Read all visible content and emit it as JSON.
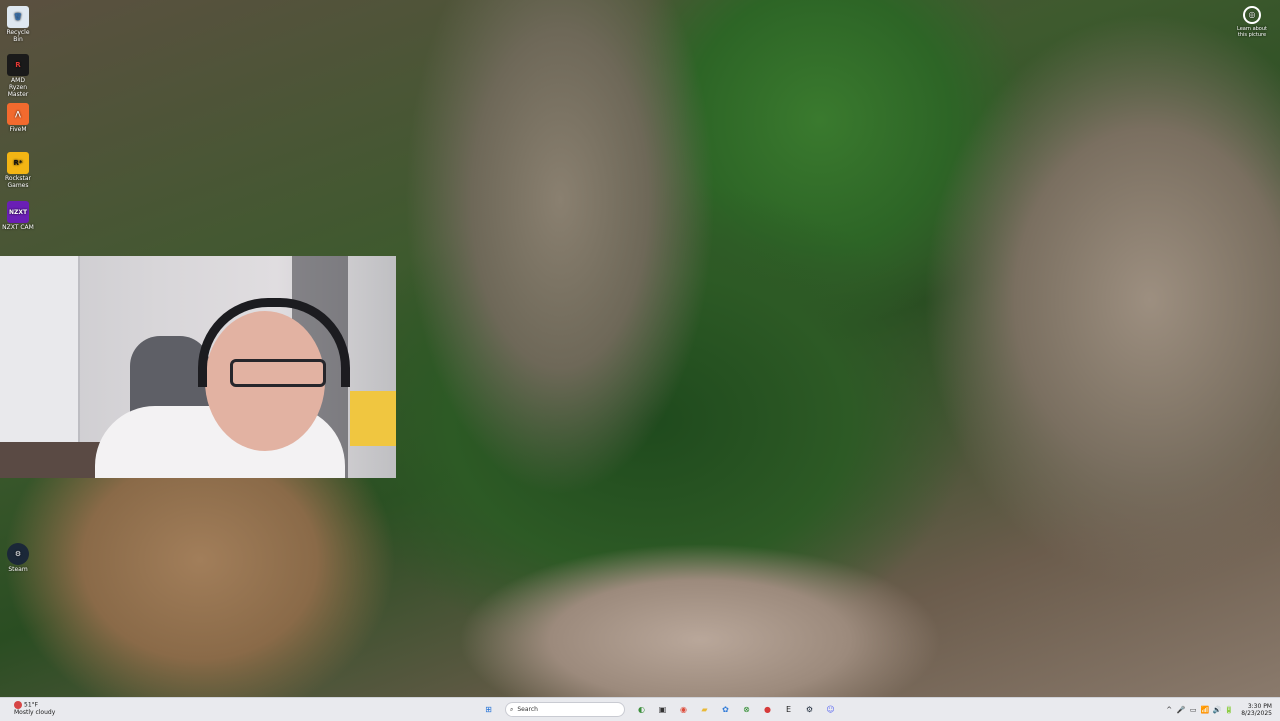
{
  "desktop": {
    "icons": [
      {
        "label": "Recycle Bin",
        "glyph": "🗑"
      },
      {
        "label": "AMD Ryzen Master",
        "glyph": "R"
      },
      {
        "label": "FiveM",
        "glyph": "⋀"
      },
      {
        "label": "Rockstar Games",
        "glyph": "R*"
      },
      {
        "label": "NZXT CAM",
        "glyph": "NZXT"
      },
      {
        "label": "Steam",
        "glyph": "⚙"
      }
    ],
    "corner_badge": {
      "line1": "Learn about",
      "line2": "this picture"
    }
  },
  "taskbar": {
    "weather": {
      "temp": "51°F",
      "condition": "Mostly cloudy"
    },
    "search_placeholder": "Search",
    "pinned": [
      {
        "name": "start-button",
        "glyph": "⊞",
        "color": "#1f6fd6"
      },
      {
        "name": "widgets-icon",
        "glyph": "◐",
        "color": "#3b8f3b"
      },
      {
        "name": "task-view-icon",
        "glyph": "▣",
        "color": "#333333"
      },
      {
        "name": "chrome-icon",
        "glyph": "◉",
        "color": "#dd4b39"
      },
      {
        "name": "file-explorer-icon",
        "glyph": "▰",
        "color": "#e9b937"
      },
      {
        "name": "photos-icon",
        "glyph": "✿",
        "color": "#2f7ad8"
      },
      {
        "name": "xbox-icon",
        "glyph": "⊗",
        "color": "#2c8a2c"
      },
      {
        "name": "record-icon",
        "glyph": "●",
        "color": "#d63a3a"
      },
      {
        "name": "epic-games-icon",
        "glyph": "E",
        "color": "#222222"
      },
      {
        "name": "steam-icon",
        "glyph": "⚙",
        "color": "#1b2838"
      },
      {
        "name": "discord-icon",
        "glyph": "☺",
        "color": "#5865f2"
      }
    ],
    "tray": [
      "^",
      "🎤",
      "▭",
      "📶",
      "🔊",
      "🔋"
    ],
    "clock": {
      "time": "3:30 PM",
      "date": "8/23/2025"
    }
  }
}
